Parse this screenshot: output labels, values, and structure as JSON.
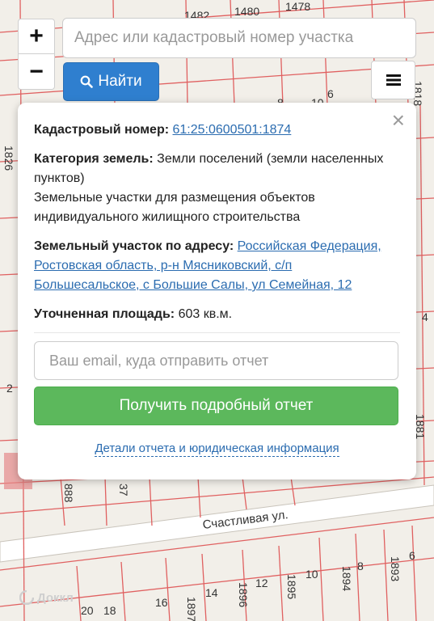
{
  "map": {
    "street_name": "Счастливая ул.",
    "plot_labels_top": [
      "1482",
      "1480",
      "1478"
    ],
    "plot_numbers_left": [
      "1826",
      "2"
    ],
    "plot_numbers_right": [
      "6",
      "1818",
      "1881",
      "4"
    ],
    "plot_numbers_bottom": [
      "888",
      "37",
      "20",
      "18",
      "16",
      "1897",
      "14",
      "1896",
      "12",
      "1895",
      "10",
      "1894",
      "8",
      "1893",
      "6",
      "8",
      "10"
    ],
    "attribution": "Доккл",
    "colors": {
      "background": "#f2efe9",
      "boundary": "#e06060",
      "street": "#ffffff"
    }
  },
  "controls": {
    "zoom_in": "+",
    "zoom_out": "−",
    "search_placeholder": "Адрес или кадастровый номер участка",
    "find_label": "Найти",
    "menu_icon": "hamburger-icon"
  },
  "popup": {
    "cadastral_label": "Кадастровый номер:",
    "cadastral_number": "61:25:0600501:1874",
    "category_label": "Категория земель:",
    "category_value": "Земли поселений (земли населенных пунктов)",
    "usage": "Земельные участки для размещения объектов индивидуального жилищного строительства",
    "address_label": "Земельный участок по адресу:",
    "address_value": "Российская Федерация, Ростовская область, р-н Мясниковский, с/п Большесальское, с Большие Салы, ул Семейная, 12",
    "area_label": "Уточненная площадь:",
    "area_value": "603 кв.м.",
    "email_placeholder": "Ваш email, куда отправить отчет",
    "report_button": "Получить подробный отчет",
    "details_link": "Детали отчета и юридическая информация",
    "close": "×"
  },
  "colors": {
    "accent_blue": "#2f7fcf",
    "accent_green": "#5cb85c",
    "link": "#2b6cb0"
  }
}
